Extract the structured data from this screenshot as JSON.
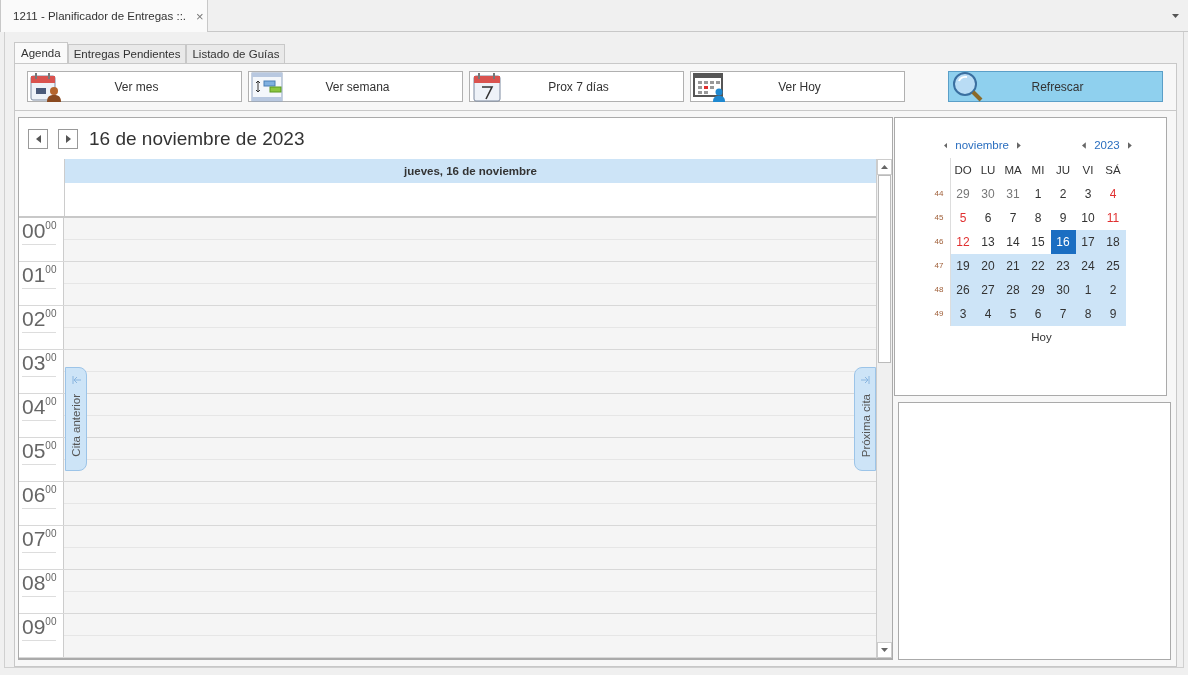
{
  "document_tab": {
    "title": "1211 - Planificador de Entregas ::.",
    "close": "×"
  },
  "tabs": [
    {
      "label": "Agenda",
      "selected": true
    },
    {
      "label": "Entregas Pendientes",
      "selected": false
    },
    {
      "label": "Listado de Guías",
      "selected": false
    }
  ],
  "toolbar": [
    {
      "label": "Ver mes",
      "kind": "month"
    },
    {
      "label": "Ver semana",
      "kind": "week"
    },
    {
      "label": "Prox 7 días",
      "kind": "seven"
    },
    {
      "label": "Ver Hoy",
      "kind": "today"
    },
    {
      "label": "Refrescar",
      "kind": "refresh"
    }
  ],
  "scheduler": {
    "title": "16 de noviembre de 2023",
    "day_header": "jueves, 16 de noviembre",
    "hours": [
      {
        "hour": "00",
        "minutes": "00"
      },
      {
        "hour": "01",
        "minutes": "00"
      },
      {
        "hour": "02",
        "minutes": "00"
      },
      {
        "hour": "03",
        "minutes": "00"
      },
      {
        "hour": "04",
        "minutes": "00"
      },
      {
        "hour": "05",
        "minutes": "00"
      },
      {
        "hour": "06",
        "minutes": "00"
      },
      {
        "hour": "07",
        "minutes": "00"
      },
      {
        "hour": "08",
        "minutes": "00"
      },
      {
        "hour": "09",
        "minutes": "00"
      }
    ],
    "previous_appointment": "Cita anterior",
    "next_appointment": "Próxima cita"
  },
  "date_navigator": {
    "month": "noviembre",
    "year": "2023",
    "weekdays": [
      "DO",
      "LU",
      "MA",
      "MI",
      "JU",
      "VI",
      "SÁ"
    ],
    "weeks": [
      {
        "number": "44",
        "days": [
          {
            "text": "29",
            "kind": "other_month",
            "selected": false,
            "in_range": false
          },
          {
            "text": "30",
            "kind": "other_month",
            "selected": false,
            "in_range": false
          },
          {
            "text": "31",
            "kind": "other_month",
            "selected": false,
            "in_range": false
          },
          {
            "text": "1",
            "kind": "day",
            "selected": false,
            "in_range": false
          },
          {
            "text": "2",
            "kind": "day",
            "selected": false,
            "in_range": false
          },
          {
            "text": "3",
            "kind": "day",
            "selected": false,
            "in_range": false
          },
          {
            "text": "4",
            "kind": "weekend",
            "selected": false,
            "in_range": false
          }
        ]
      },
      {
        "number": "45",
        "days": [
          {
            "text": "5",
            "kind": "weekend",
            "selected": false,
            "in_range": false
          },
          {
            "text": "6",
            "kind": "day",
            "selected": false,
            "in_range": false
          },
          {
            "text": "7",
            "kind": "day",
            "selected": false,
            "in_range": false
          },
          {
            "text": "8",
            "kind": "day",
            "selected": false,
            "in_range": false
          },
          {
            "text": "9",
            "kind": "day",
            "selected": false,
            "in_range": false
          },
          {
            "text": "10",
            "kind": "day",
            "selected": false,
            "in_range": false
          },
          {
            "text": "11",
            "kind": "weekend",
            "selected": false,
            "in_range": false
          }
        ]
      },
      {
        "number": "46",
        "days": [
          {
            "text": "12",
            "kind": "weekend",
            "selected": false,
            "in_range": false
          },
          {
            "text": "13",
            "kind": "day",
            "selected": false,
            "in_range": false
          },
          {
            "text": "14",
            "kind": "day",
            "selected": false,
            "in_range": false
          },
          {
            "text": "15",
            "kind": "day",
            "selected": false,
            "in_range": false
          },
          {
            "text": "16",
            "kind": "day",
            "selected": true,
            "in_range": true
          },
          {
            "text": "17",
            "kind": "day",
            "selected": false,
            "in_range": true
          },
          {
            "text": "18",
            "kind": "day",
            "selected": false,
            "in_range": true
          }
        ]
      },
      {
        "number": "47",
        "days": [
          {
            "text": "19",
            "kind": "day",
            "selected": false,
            "in_range": true
          },
          {
            "text": "20",
            "kind": "day",
            "selected": false,
            "in_range": true
          },
          {
            "text": "21",
            "kind": "day",
            "selected": false,
            "in_range": true
          },
          {
            "text": "22",
            "kind": "day",
            "selected": false,
            "in_range": true
          },
          {
            "text": "23",
            "kind": "day",
            "selected": false,
            "in_range": true
          },
          {
            "text": "24",
            "kind": "day",
            "selected": false,
            "in_range": true
          },
          {
            "text": "25",
            "kind": "day",
            "selected": false,
            "in_range": true
          }
        ]
      },
      {
        "number": "48",
        "days": [
          {
            "text": "26",
            "kind": "day",
            "selected": false,
            "in_range": true
          },
          {
            "text": "27",
            "kind": "day",
            "selected": false,
            "in_range": true
          },
          {
            "text": "28",
            "kind": "day",
            "selected": false,
            "in_range": true
          },
          {
            "text": "29",
            "kind": "day",
            "selected": false,
            "in_range": true
          },
          {
            "text": "30",
            "kind": "day",
            "selected": false,
            "in_range": true
          },
          {
            "text": "1",
            "kind": "day",
            "selected": false,
            "in_range": true
          },
          {
            "text": "2",
            "kind": "day",
            "selected": false,
            "in_range": true
          }
        ]
      },
      {
        "number": "49",
        "days": [
          {
            "text": "3",
            "kind": "day",
            "selected": false,
            "in_range": true
          },
          {
            "text": "4",
            "kind": "day",
            "selected": false,
            "in_range": true
          },
          {
            "text": "5",
            "kind": "day",
            "selected": false,
            "in_range": true
          },
          {
            "text": "6",
            "kind": "day",
            "selected": false,
            "in_range": true
          },
          {
            "text": "7",
            "kind": "day",
            "selected": false,
            "in_range": true
          },
          {
            "text": "8",
            "kind": "day",
            "selected": false,
            "in_range": true
          },
          {
            "text": "9",
            "kind": "day",
            "selected": false,
            "in_range": true
          }
        ]
      }
    ],
    "today_button": "Hoy"
  }
}
